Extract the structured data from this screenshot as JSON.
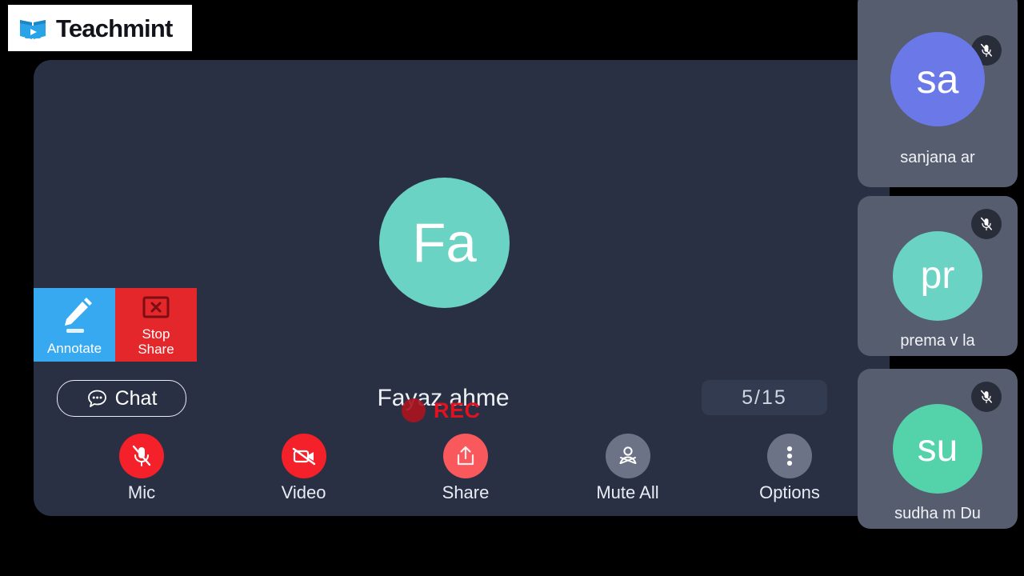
{
  "brand": {
    "name": "Teachmint",
    "logo_icon": "teachmint-book-play-icon",
    "logo_color": "#2aa3e8",
    "bar_background": "#ffffff"
  },
  "stage": {
    "background": "#2a3043",
    "speaker": {
      "initials": "Fa",
      "name": "Fayaz ahme",
      "avatar_color": "#6bd3c4"
    },
    "recording": {
      "label": "REC",
      "dot_icon": "record-dot-icon",
      "color": "#e1111f"
    },
    "participant_counter": "5/15"
  },
  "share_controls": [
    {
      "id": "annotate",
      "label": "Annotate",
      "icon": "pencil-icon",
      "color": "#37a9f0"
    },
    {
      "id": "stop-share",
      "label_line1": "Stop",
      "label_line2": "Share",
      "icon": "stop-share-x-box-icon",
      "color": "#e4272b"
    }
  ],
  "chat": {
    "label": "Chat",
    "icon": "chat-bubble-dots-icon"
  },
  "toolbar": [
    {
      "id": "mic",
      "label": "Mic",
      "icon": "mic-muted-icon",
      "color": "#f4202a"
    },
    {
      "id": "video",
      "label": "Video",
      "icon": "video-off-icon",
      "color": "#f4202a"
    },
    {
      "id": "share",
      "label": "Share",
      "icon": "share-upload-icon",
      "color": "#f9585d"
    },
    {
      "id": "mute-all",
      "label": "Mute All",
      "icon": "mute-all-person-icon",
      "color": "#6d7386"
    },
    {
      "id": "options",
      "label": "Options",
      "icon": "kebab-menu-icon",
      "color": "#6d7386"
    }
  ],
  "participants": [
    {
      "initials": "sa",
      "name": "sanjana ar",
      "avatar_color": "#6b79e8",
      "mic_icon": "mic-muted-icon"
    },
    {
      "initials": "pr",
      "name": "prema v la",
      "avatar_color": "#6bd3c4",
      "mic_icon": "mic-muted-icon"
    },
    {
      "initials": "su",
      "name": "sudha m Du",
      "avatar_color": "#54d3ab",
      "mic_icon": "mic-muted-icon"
    }
  ]
}
